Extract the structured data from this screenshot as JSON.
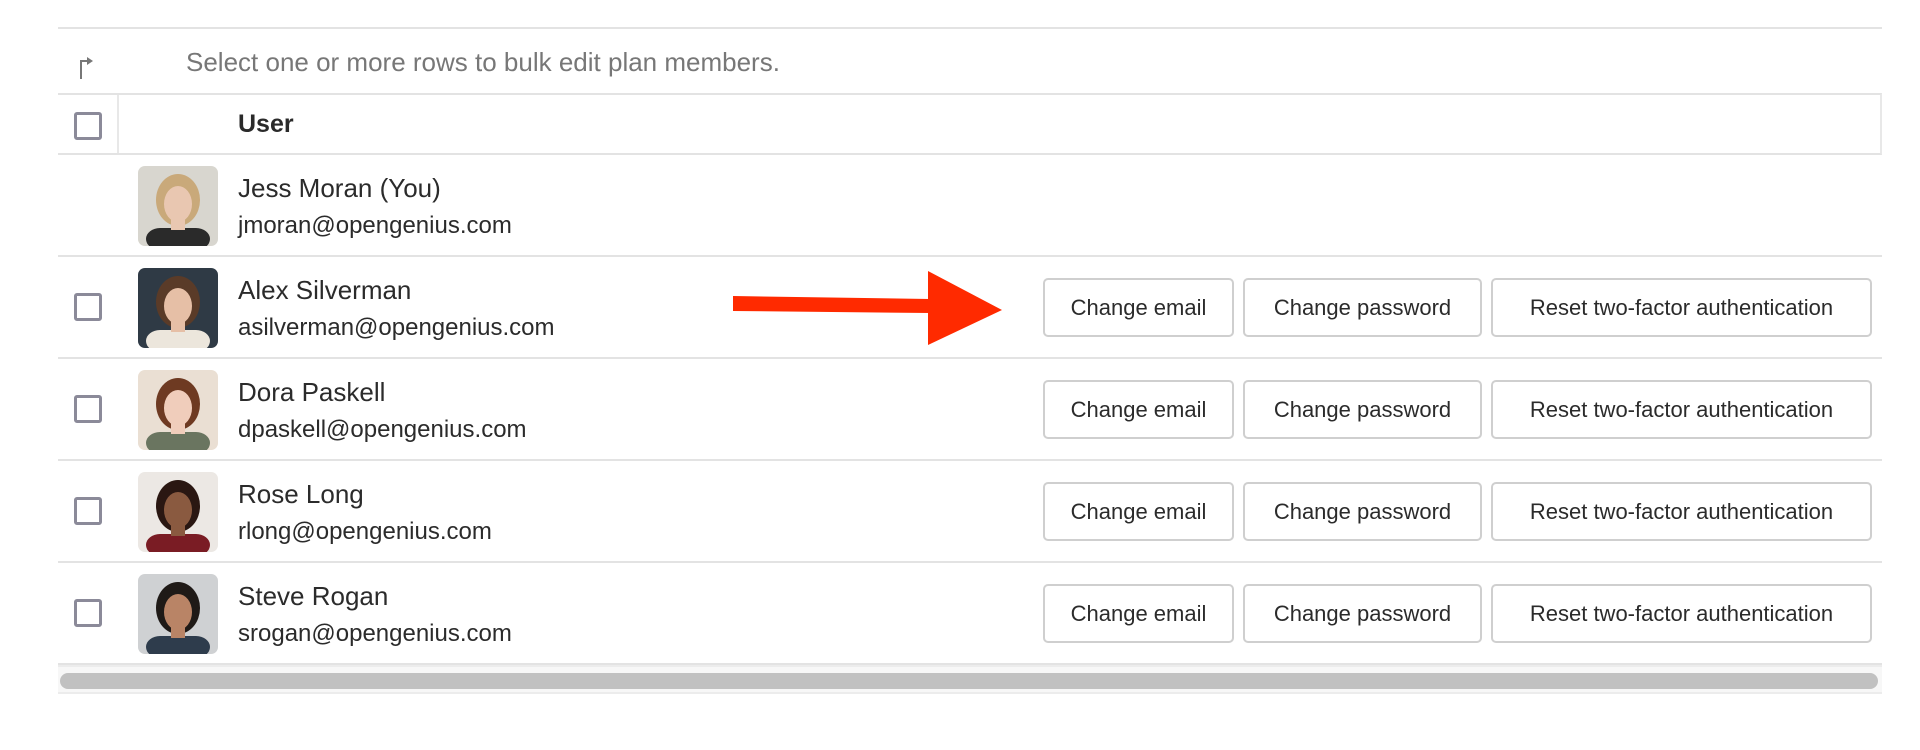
{
  "hint": {
    "icon": "corner-arrow-icon",
    "text": "Select one or more rows to bulk edit plan members."
  },
  "table": {
    "select_all_icon": "checkbox-unchecked",
    "column_header": "User",
    "rows": [
      {
        "name": "Jess Moran (You)",
        "email": "jmoran@opengenius.com",
        "selectable": false,
        "actions": false,
        "avatar_colors": {
          "bg": "#d8d6cf",
          "hair": "#c9a97a",
          "skin": "#e9c7b1",
          "shirt": "#2a2a2a"
        }
      },
      {
        "name": "Alex Silverman",
        "email": "asilverman@opengenius.com",
        "selectable": true,
        "actions": true,
        "avatar_colors": {
          "bg": "#2f3a45",
          "hair": "#5a3b28",
          "skin": "#e6bfa6",
          "shirt": "#ece6dc"
        }
      },
      {
        "name": "Dora Paskell",
        "email": "dpaskell@opengenius.com",
        "selectable": true,
        "actions": true,
        "avatar_colors": {
          "bg": "#eadfd3",
          "hair": "#6e3a22",
          "skin": "#f0cdbb",
          "shirt": "#6a7560"
        }
      },
      {
        "name": "Rose Long",
        "email": "rlong@opengenius.com",
        "selectable": true,
        "actions": true,
        "avatar_colors": {
          "bg": "#ece8e4",
          "hair": "#2a1712",
          "skin": "#8a5a40",
          "shirt": "#7a1c24"
        }
      },
      {
        "name": "Steve Rogan",
        "email": "srogan@opengenius.com",
        "selectable": true,
        "actions": true,
        "avatar_colors": {
          "bg": "#cfd1d3",
          "hair": "#1f1a17",
          "skin": "#b98466",
          "shirt": "#2e3c4c"
        }
      }
    ]
  },
  "actions": {
    "change_email": "Change email",
    "change_password": "Change password",
    "reset_tfa": "Reset two-factor authentication"
  },
  "annotation": {
    "type": "arrow",
    "color": "#ff2a00",
    "points_to": "row-actions-alex-silverman"
  },
  "colors": {
    "border": "#e3e3e3",
    "checkbox": "#8b8a99",
    "button_border": "#cfcfcf",
    "hint_text": "#777777",
    "scroll_thumb": "#c1c1c1"
  }
}
